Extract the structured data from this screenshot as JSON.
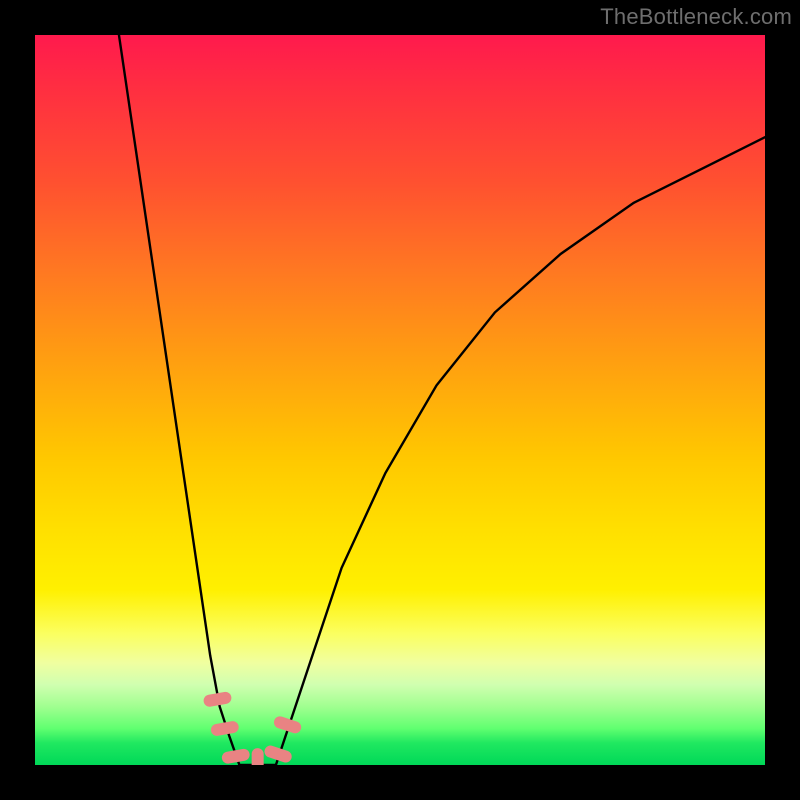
{
  "watermark": "TheBottleneck.com",
  "colors": {
    "frame": "#000000",
    "curve": "#000000",
    "marker": "#e98383",
    "gradient_top": "#ff1a4d",
    "gradient_bottom": "#00d858"
  },
  "chart_data": {
    "type": "line",
    "title": "",
    "xlabel": "",
    "ylabel": "",
    "xlim": [
      0,
      100
    ],
    "ylim": [
      0,
      100
    ],
    "grid": false,
    "legend": false,
    "annotations": [],
    "series": [
      {
        "name": "left-branch",
        "x": [
          11.5,
          14,
          16.5,
          19,
          21.5,
          24,
          25.3,
          26.6,
          28
        ],
        "values": [
          100,
          83,
          66,
          49,
          32,
          15,
          8,
          4,
          0
        ]
      },
      {
        "name": "right-branch",
        "x": [
          33,
          35,
          38,
          42,
          48,
          55,
          63,
          72,
          82,
          92,
          100
        ],
        "values": [
          0,
          6,
          15,
          27,
          40,
          52,
          62,
          70,
          77,
          82,
          86
        ]
      }
    ],
    "markers": [
      {
        "x": 25.0,
        "y": 9.0
      },
      {
        "x": 26.0,
        "y": 5.0
      },
      {
        "x": 27.5,
        "y": 1.2
      },
      {
        "x": 30.5,
        "y": 0.4
      },
      {
        "x": 33.3,
        "y": 1.5
      },
      {
        "x": 34.6,
        "y": 5.5
      }
    ]
  }
}
